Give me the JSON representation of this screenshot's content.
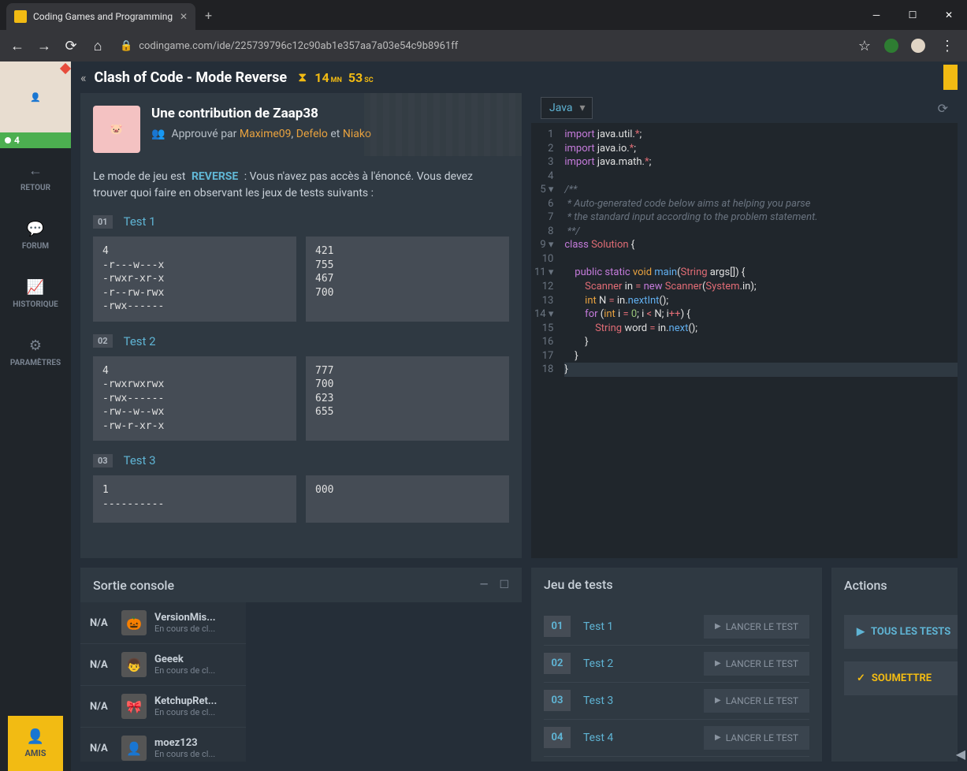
{
  "browser": {
    "tab_title": "Coding Games and Programming",
    "url": "codingame.com/ide/225739796c12c90ab1e357aa7a03e54c9b8961ff"
  },
  "sidebar": {
    "online_count": "4",
    "items": [
      {
        "icon": "←",
        "label": "RETOUR"
      },
      {
        "icon": "💬",
        "label": "FORUM"
      },
      {
        "icon": "📈",
        "label": "HISTORIQUE"
      },
      {
        "icon": "⚙",
        "label": "PARAMÈTRES"
      }
    ],
    "amis": {
      "icon": "👤",
      "label": "AMIS"
    }
  },
  "header": {
    "title": "Clash of Code - Mode Reverse",
    "timer_mn": "14",
    "timer_mn_label": "MN",
    "timer_sc": "53",
    "timer_sc_label": "SC"
  },
  "contribution": {
    "title_prefix": "Une contribution de ",
    "author": "Zaap38",
    "approved_by_label": "Approuvé par ",
    "approvers": [
      "Maxime09",
      "Defelo",
      "Niako"
    ],
    "and_word": " et "
  },
  "mode_description": {
    "prefix": "Le mode de jeu est ",
    "tag": "REVERSE",
    "suffix": " : Vous n'avez pas accès à l'énoncé. Vous devez trouver quoi faire en observant les jeux de tests suivants :"
  },
  "problem_tests": [
    {
      "num": "01",
      "name": "Test 1",
      "input": "4\n-r---w---x\n-rwxr-xr-x\n-r--rw-rwx\n-rwx------",
      "output": "421\n755\n467\n700"
    },
    {
      "num": "02",
      "name": "Test 2",
      "input": "4\n-rwxrwxrwx\n-rwx------\n-rw--w--wx\n-rw-r-xr-x",
      "output": "777\n700\n623\n655"
    },
    {
      "num": "03",
      "name": "Test 3",
      "input": "1\n----------",
      "output": "000"
    }
  ],
  "editor": {
    "language": "Java",
    "code_html": "<span class='kw'>import</span> <span class='id'>java.util.</span><span class='op'>*</span>;\n<span class='kw'>import</span> <span class='id'>java.io.</span><span class='op'>*</span>;\n<span class='kw'>import</span> <span class='id'>java.math.</span><span class='op'>*</span>;\n\n<span class='cm'>/**</span>\n<span class='cm'> * Auto-generated code below aims at helping you parse</span>\n<span class='cm'> * the standard input according to the problem statement.</span>\n<span class='cm'> **/</span>\n<span class='kw'>class</span> <span class='type'>Solution</span> {\n\n    <span class='kw'>public</span> <span class='kw'>static</span> <span class='kw2'>void</span> <span class='fn'>main</span>(<span class='type'>String</span> <span class='id'>args</span>[]) {\n        <span class='type'>Scanner</span> <span class='id'>in</span> <span class='op'>=</span> <span class='kw'>new</span> <span class='type'>Scanner</span>(<span class='type'>System</span>.<span class='id'>in</span>);\n        <span class='kw2'>int</span> <span class='id'>N</span> <span class='op'>=</span> <span class='id'>in</span>.<span class='fn'>nextInt</span>();\n        <span class='kw'>for</span> (<span class='kw2'>int</span> <span class='id'>i</span> <span class='op'>=</span> <span class='str'>0</span>; <span class='id'>i</span> <span class='op'>&lt;</span> <span class='id'>N</span>; <span class='id'>i</span><span class='op'>++</span>) {\n            <span class='type'>String</span> <span class='id'>word</span> <span class='op'>=</span> <span class='id'>in</span>.<span class='fn'>next</span>();\n        }\n    }\n<span class='line-highlight'>}</span>",
    "line_count": 18,
    "fold_lines": [
      5,
      9,
      11,
      14
    ]
  },
  "console": {
    "title": "Sortie console",
    "players": [
      {
        "rank": "N/A",
        "avatar": "🎃",
        "name": "VersionMis...",
        "status": "En cours de cl..."
      },
      {
        "rank": "N/A",
        "avatar": "👦",
        "name": "Geeek",
        "status": "En cours de cl..."
      },
      {
        "rank": "N/A",
        "avatar": "🎀",
        "name": "KetchupRet...",
        "status": "En cours de cl..."
      },
      {
        "rank": "N/A",
        "avatar": "👤",
        "name": "moez123",
        "status": "En cours de cl..."
      }
    ]
  },
  "tests_panel": {
    "title": "Jeu de tests",
    "run_label": "LANCER LE TEST",
    "tests": [
      {
        "num": "01",
        "name": "Test 1"
      },
      {
        "num": "02",
        "name": "Test 2"
      },
      {
        "num": "03",
        "name": "Test 3"
      },
      {
        "num": "04",
        "name": "Test 4"
      }
    ]
  },
  "actions_panel": {
    "title": "Actions",
    "all_tests": "TOUS LES TESTS",
    "submit": "SOUMETTRE"
  }
}
